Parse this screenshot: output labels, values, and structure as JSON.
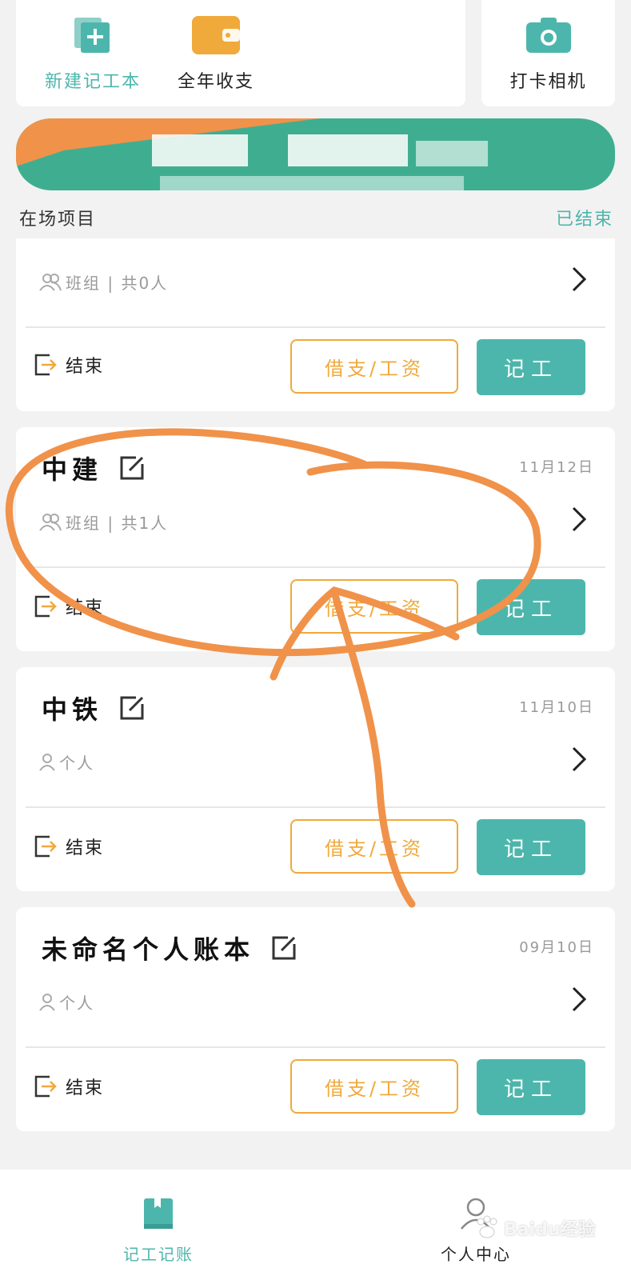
{
  "quick_actions": {
    "new_book": "新建记工本",
    "annual": "全年收支",
    "camera": "打卡相机"
  },
  "section": {
    "left": "在场项目",
    "right": "已结束"
  },
  "projects": [
    {
      "title": "",
      "date": "",
      "meta": "班组 | 共0人",
      "end": "结束",
      "wage": "借支/工资",
      "record": "记工"
    },
    {
      "title": "中建",
      "date": "11月12日",
      "meta": "班组 | 共1人",
      "end": "结束",
      "wage": "借支/工资",
      "record": "记工"
    },
    {
      "title": "中铁",
      "date": "11月10日",
      "meta": "个人",
      "end": "结束",
      "wage": "借支/工资",
      "record": "记工"
    },
    {
      "title": "未命名个人账本",
      "date": "09月10日",
      "meta": "个人",
      "end": "结束",
      "wage": "借支/工资",
      "record": "记工"
    }
  ],
  "nav": {
    "records": "记工记账",
    "profile": "个人中心"
  },
  "watermark": "Baidu经验",
  "colors": {
    "accent": "#4db6ac",
    "orange": "#f0a93b",
    "annotation": "#f0924a"
  },
  "icons": {
    "new_book": "add-book-icon",
    "annual": "wallet-icon",
    "camera": "camera-icon",
    "edit": "edit-icon",
    "team": "team-icon",
    "person": "person-icon",
    "end": "exit-icon",
    "arrow": "chevron-right-icon"
  }
}
